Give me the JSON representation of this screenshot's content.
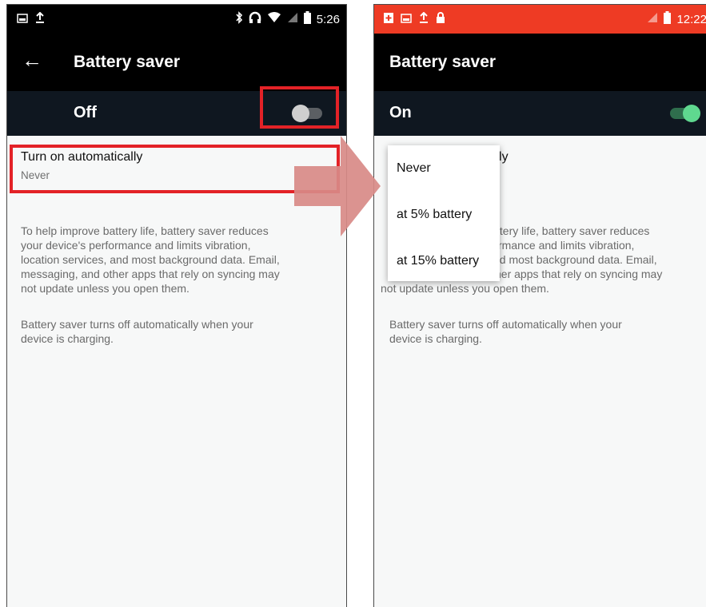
{
  "left": {
    "status_time": "5:26",
    "title": "Battery saver",
    "toggle_label": "Off",
    "toggle_on": false,
    "auto_title": "Turn on automatically",
    "auto_value": "Never",
    "desc_lines": [
      "To help improve battery life, battery saver reduces",
      "your device's performance and limits vibration,",
      "location services, and most background data. Email,",
      "messaging, and other apps that rely on syncing may",
      "not update unless you open them."
    ],
    "charging_lines": [
      "Battery saver turns off automatically when your",
      "device is charging."
    ]
  },
  "right": {
    "status_time": "12:22",
    "title": "Battery saver",
    "toggle_label": "On",
    "toggle_on": true,
    "auto_title_visible": "ically",
    "desc_lines_partial": [
      "ttery life, battery saver reduces",
      "rmance and limits vibration,",
      "nd most background data. Email,",
      "her apps that rely on syncing may",
      "not update unless you open them."
    ],
    "charging_lines": [
      "Battery saver turns off automatically when your",
      "device is charging."
    ],
    "menu": {
      "items": [
        "Never",
        "at 5% battery",
        "at 15% battery"
      ]
    }
  },
  "colors": {
    "highlight": "#e32227",
    "arrow": "#d88a87",
    "status_bar_right": "#ee3b24",
    "switch_on": "#5fd88f",
    "switch_off": "#cfcfcf"
  }
}
